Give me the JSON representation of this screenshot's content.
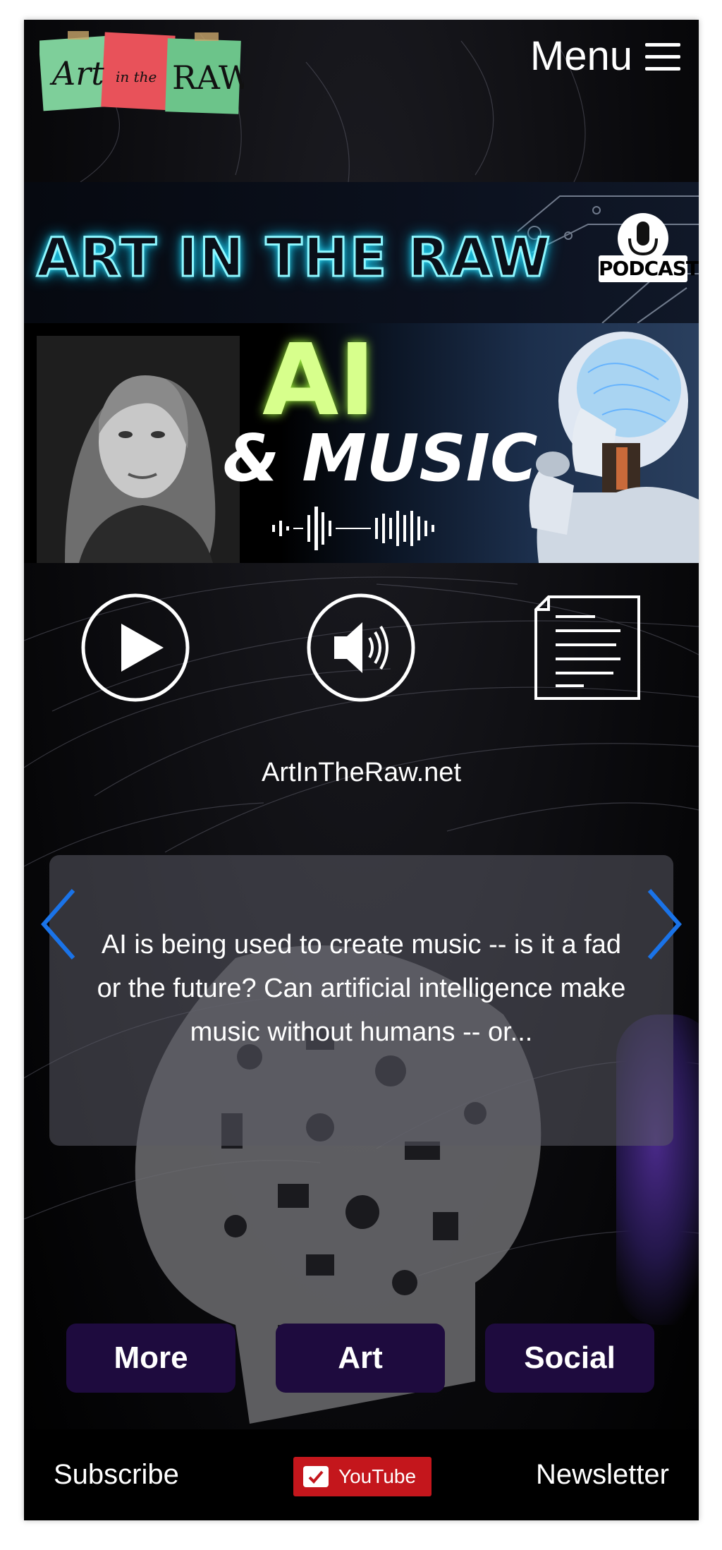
{
  "header": {
    "logo_text_1": "Art",
    "logo_text_2": "in the",
    "logo_text_3": "RAW",
    "menu_label": "Menu"
  },
  "banner": {
    "title": "ART IN THE RAW",
    "podcast_label": "PODCAST",
    "ai_label": "AI",
    "music_label": "& MUSIC"
  },
  "controls": {
    "play_icon": "play-icon",
    "volume_icon": "volume-icon",
    "transcript_icon": "document-icon"
  },
  "site_url": "ArtInTheRaw.net",
  "carousel": {
    "text": "AI is being used to create music -- is it a fad or the future?  Can artificial intelligence make music without humans -- or..."
  },
  "nav": {
    "more": "More",
    "art": "Art",
    "social": "Social"
  },
  "footer": {
    "subscribe": "Subscribe",
    "youtube": "YouTube",
    "newsletter": "Newsletter"
  },
  "colors": {
    "neon_cyan": "#8ef7ff",
    "ai_green": "#d7ff8c",
    "nav_button": "#1e0b3e",
    "youtube_red": "#c4161c",
    "chevron_blue": "#1a73e8"
  }
}
